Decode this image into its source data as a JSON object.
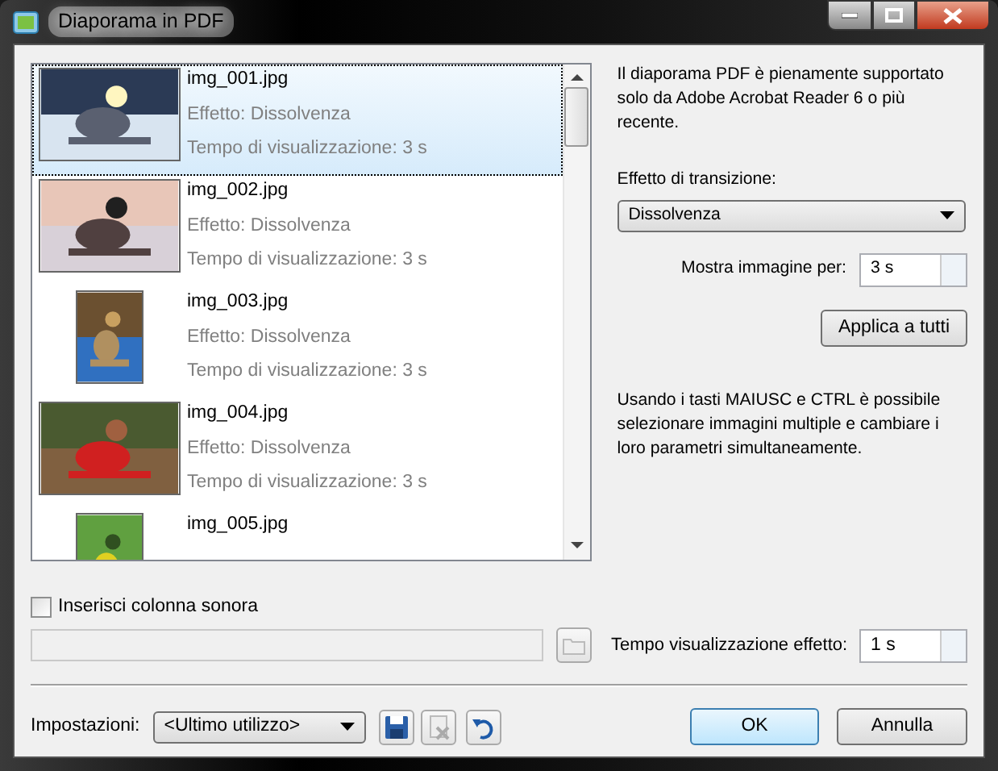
{
  "window": {
    "title": "Diaporama in PDF"
  },
  "list": {
    "items": [
      {
        "file": "img_001.jpg",
        "effect": "Effetto: Dissolvenza",
        "time": "Tempo di visualizzazione: 3 s",
        "selected": true,
        "kind": "picture"
      },
      {
        "file": "img_002.jpg",
        "effect": "Effetto: Dissolvenza",
        "time": "Tempo di visualizzazione: 3 s",
        "selected": false,
        "kind": "picture"
      },
      {
        "file": "img_003.jpg",
        "effect": "Effetto: Dissolvenza",
        "time": "Tempo di visualizzazione: 3 s",
        "selected": false,
        "kind": "picture"
      },
      {
        "file": "img_004.jpg",
        "effect": "Effetto: Dissolvenza",
        "time": "Tempo di visualizzazione: 3 s",
        "selected": false,
        "kind": "picture"
      },
      {
        "file": "img_005.jpg",
        "selected": false,
        "kind": "picture"
      }
    ]
  },
  "info": "Il diaporama PDF è pienamente supportato solo da Adobe Acrobat Reader 6 o più recente.",
  "transition": {
    "label": "Effetto di transizione:",
    "value": "Dissolvenza"
  },
  "show_for": {
    "label": "Mostra immagine per:",
    "value": "3 s"
  },
  "apply_button": "Applica a tutti",
  "hint": "Usando i tasti MAIUSC e CTRL è possibile selezionare immagini multiple e cambiare i loro parametri simultaneamente.",
  "soundtrack": {
    "label": "Inserisci colonna sonora",
    "checked": false
  },
  "effect_time": {
    "label": "Tempo visualizzazione effetto:",
    "value": "1 s"
  },
  "settings": {
    "label": "Impostazioni:",
    "value": "<Ultimo utilizzo>"
  },
  "buttons": {
    "ok": "OK",
    "cancel": "Annulla"
  }
}
